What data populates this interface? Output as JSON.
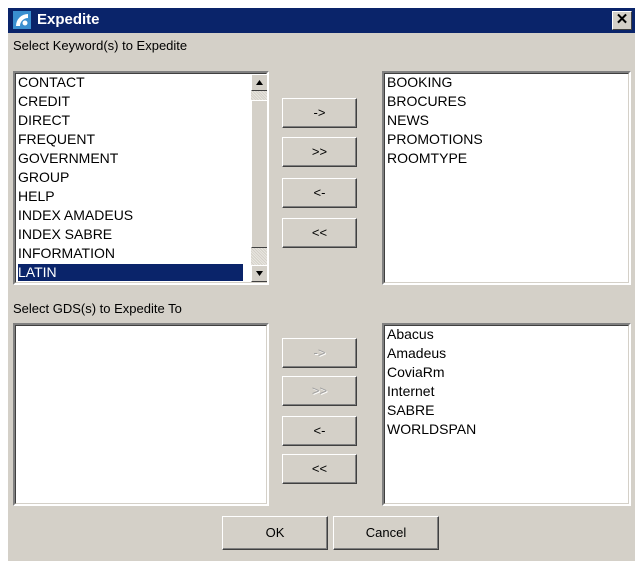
{
  "window": {
    "title": "Expedite",
    "close_glyph": "✕",
    "icon": "app-icon"
  },
  "keywords": {
    "label": "Select Keyword(s) to Expedite",
    "available": [
      "CONTACT",
      "CREDIT",
      "DIRECT",
      "FREQUENT",
      "GOVERNMENT",
      "GROUP",
      "HELP",
      "INDEX AMADEUS",
      "INDEX SABRE",
      "INFORMATION",
      "LATIN"
    ],
    "selected_item": "LATIN",
    "chosen": [
      "BOOKING",
      "BROCURES",
      "NEWS",
      "PROMOTIONS",
      "ROOMTYPE"
    ],
    "buttons": {
      "add": "->",
      "add_all": ">>",
      "remove": "<-",
      "remove_all": "<<"
    }
  },
  "gds": {
    "label": "Select GDS(s) to Expedite To",
    "available": [],
    "chosen": [
      "Abacus",
      "Amadeus",
      "CoviaRm",
      "Internet",
      "SABRE",
      "WORLDSPAN"
    ],
    "buttons": {
      "add": "->",
      "add_all": ">>",
      "remove": "<-",
      "remove_all": "<<"
    },
    "disabled_buttons": [
      "add",
      "add_all"
    ]
  },
  "footer": {
    "ok_label": "OK",
    "cancel_label": "Cancel"
  },
  "colors": {
    "titlebar": "#0a246a",
    "face": "#d4d0c8",
    "selection": "#0a246a"
  }
}
